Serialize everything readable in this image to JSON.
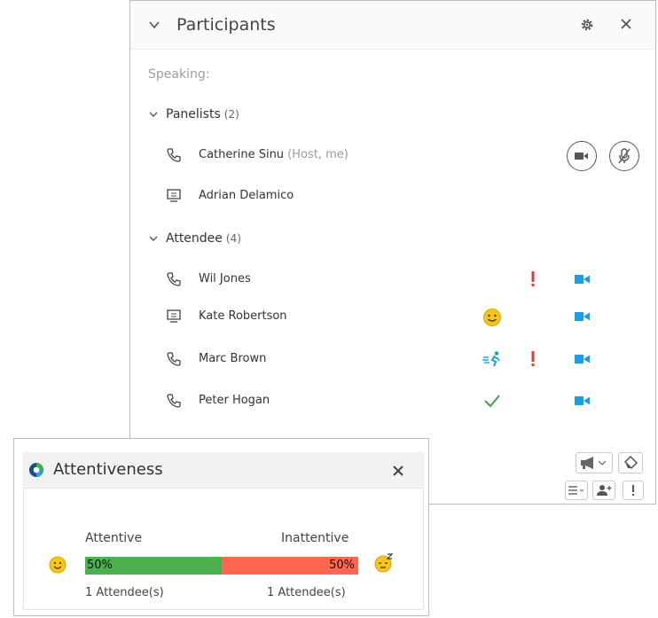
{
  "participants_panel": {
    "title": "Participants",
    "speaking_label": "Speaking:",
    "panelists": {
      "label": "Panelists",
      "count": "(2)",
      "members": [
        {
          "name": "Catherine Sinu",
          "role": "(Host, me)",
          "device": "phone"
        },
        {
          "name": "Adrian Delamico",
          "role": "",
          "device": "computer"
        }
      ]
    },
    "attendees": {
      "label": "Attendee",
      "count": "(4)",
      "members": [
        {
          "name": "Wil Jones",
          "device": "phone",
          "alert": true,
          "video": true
        },
        {
          "name": "Kate Robertson",
          "device": "computer",
          "emoji": "smile",
          "video": true
        },
        {
          "name": "Marc Brown",
          "device": "phone",
          "emoji": "running",
          "alert": true,
          "video": true
        },
        {
          "name": "Peter Hogan",
          "device": "phone",
          "emoji": "check",
          "video": true
        }
      ]
    },
    "icons": {
      "chevron": "chevron-down-icon",
      "settings": "gear-icon",
      "close": "close-icon",
      "phone": "phone-icon",
      "computer": "computer-icon",
      "video_toggle": "video-camera-icon",
      "mute_toggle": "microphone-mute-icon",
      "alert": "exclamation-icon",
      "announce": "megaphone-icon",
      "eraser": "eraser-icon",
      "list": "list-icon",
      "add_user": "add-user-icon",
      "warning": "exclamation-icon"
    },
    "colors": {
      "accent": "#1a9ee0",
      "alert": "#e53935",
      "check": "#43a047",
      "emoji": "#f5c518"
    }
  },
  "attentiveness": {
    "title": "Attentiveness",
    "attentive_label": "Attentive",
    "inattentive_label": "Inattentive",
    "attentive_pct": 50,
    "inattentive_pct": 50,
    "attentive_pct_text": "50%",
    "inattentive_pct_text": "50%",
    "attentive_count": "1 Attendee(s)",
    "inattentive_count": "1 Attendee(s)",
    "colors": {
      "attentive": "#4caf50",
      "inattentive": "#ff6650"
    }
  }
}
